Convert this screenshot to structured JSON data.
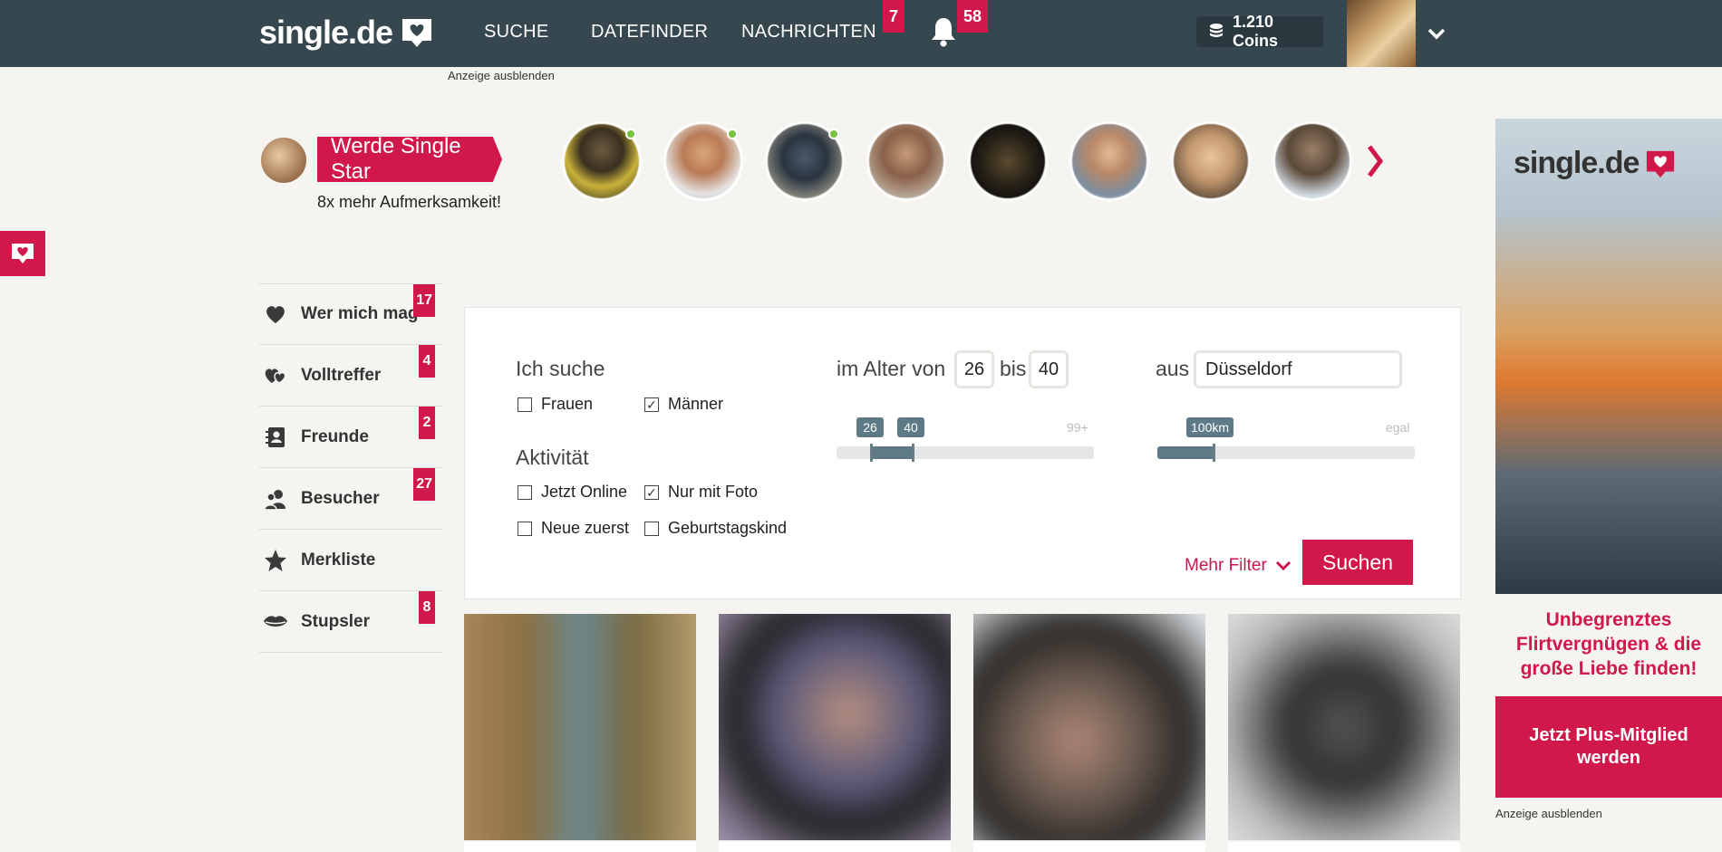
{
  "header": {
    "logo": "single.de",
    "nav": [
      {
        "label": "SUCHE"
      },
      {
        "label": "DATEFINDER"
      },
      {
        "label": "NACHRICHTEN",
        "badge": "7"
      }
    ],
    "notifications_badge": "58",
    "coins": "1.210 Coins",
    "ad_hide": "Anzeige ausblenden"
  },
  "stories": {
    "cta": "Werde Single Star",
    "subtitle": "8x mehr Aufmerksamkeit!"
  },
  "sidebar": {
    "items": [
      {
        "label": "Wer mich mag",
        "badge": "17",
        "icon": "heart-icon"
      },
      {
        "label": "Volltreffer",
        "badge": "4",
        "icon": "double-heart-icon"
      },
      {
        "label": "Freunde",
        "badge": "2",
        "icon": "contacts-icon"
      },
      {
        "label": "Besucher",
        "badge": "27",
        "icon": "visitors-icon"
      },
      {
        "label": "Merkliste",
        "badge": "",
        "icon": "star-icon"
      },
      {
        "label": "Stupsler",
        "badge": "8",
        "icon": "lips-icon"
      }
    ]
  },
  "search": {
    "looking_for_heading": "Ich suche",
    "gender": [
      {
        "label": "Frauen",
        "checked": false
      },
      {
        "label": "Männer",
        "checked": true
      }
    ],
    "activity_heading": "Aktivität",
    "activity": [
      {
        "label": "Jetzt Online",
        "checked": false
      },
      {
        "label": "Nur mit Foto",
        "checked": true
      },
      {
        "label": "Neue zuerst",
        "checked": false
      },
      {
        "label": "Geburtstagskind",
        "checked": false
      }
    ],
    "age_label": "im Alter von",
    "age_from": "26",
    "age_to_label": "bis",
    "age_to": "40",
    "age_slider_max": "99+",
    "age_tag_min": "26",
    "age_tag_max": "40",
    "from_label": "aus",
    "city": "Düsseldorf",
    "distance_tag": "100km",
    "distance_end": "egal",
    "distance_fraction": 0.22,
    "more_filter": "Mehr Filter",
    "submit": "Suchen"
  },
  "ad": {
    "logo": "single.de",
    "copy_lines": [
      "Unbegrenztes",
      "Flirtvergnügen & die",
      "große Liebe finden!"
    ],
    "cta": "Jetzt Plus-Mitglied werden",
    "hide": "Anzeige ausblenden",
    "brand_color": "#d1184b"
  },
  "colors": {
    "header_bg": "#36474f",
    "accent": "#d1184b",
    "online": "#7ac142"
  }
}
